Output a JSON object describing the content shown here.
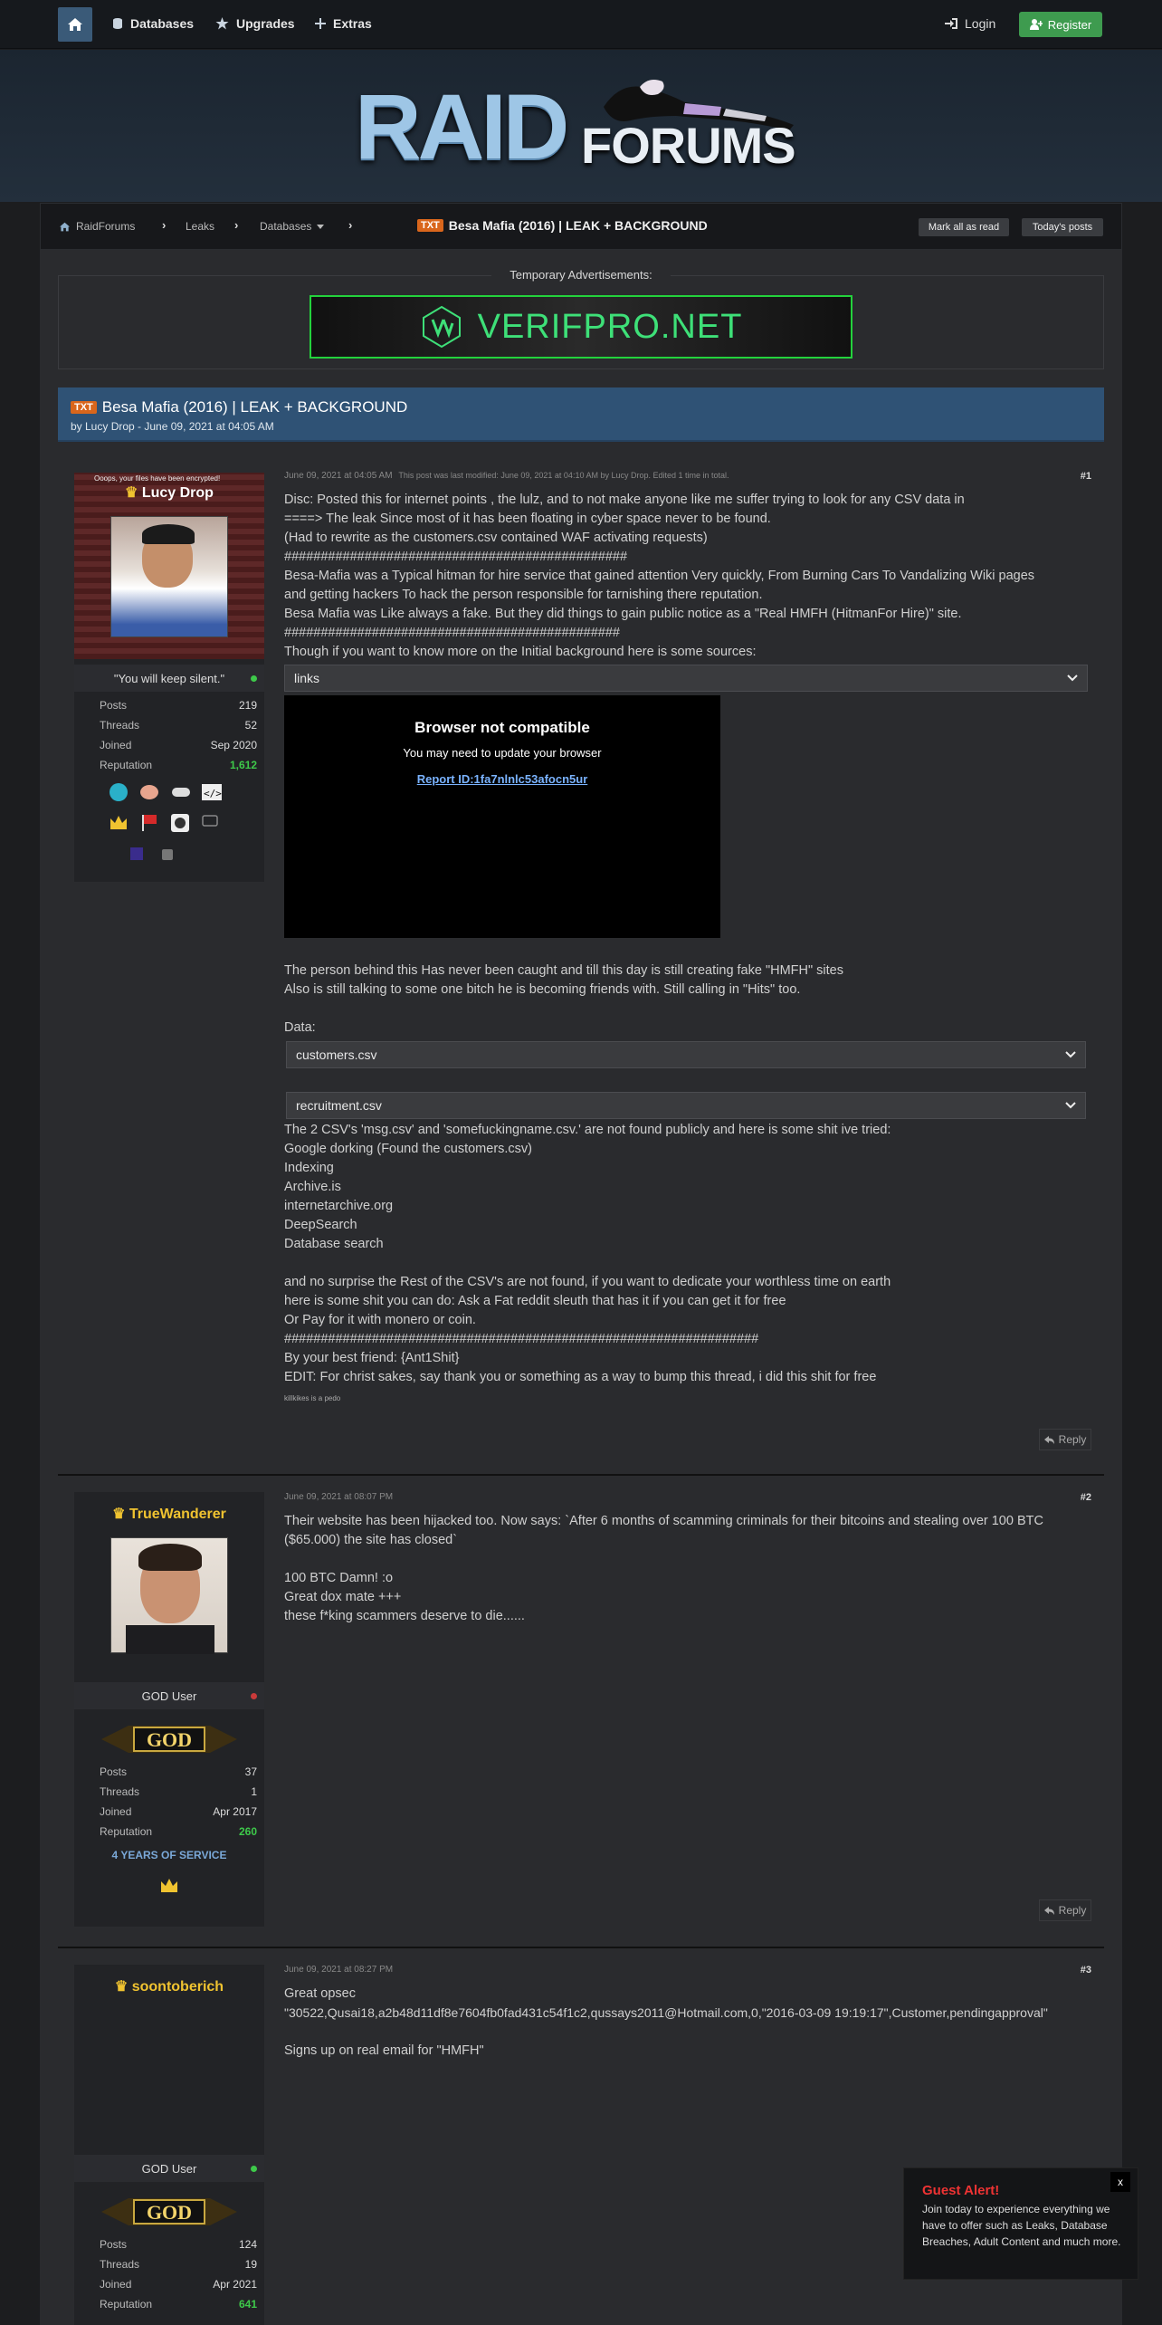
{
  "nav": {
    "databases": "Databases",
    "upgrades": "Upgrades",
    "extras": "Extras",
    "login": "Login",
    "register": "Register"
  },
  "logo": {
    "raid": "RAID",
    "forums": "FORUMS"
  },
  "breadcrumb": {
    "home": "RaidForums",
    "leaks": "Leaks",
    "databases": "Databases",
    "tag": "TXT",
    "title": "Besa Mafia (2016) | LEAK + BACKGROUND",
    "mark_read": "Mark all as read",
    "todays": "Today's posts"
  },
  "ads": {
    "label": "Temporary Advertisements:",
    "ad_text": "VERIFPRO.NET"
  },
  "thread": {
    "tag": "TXT",
    "title": "Besa Mafia (2016) | LEAK + BACKGROUND",
    "byline": "by Lucy Drop - June 09, 2021 at 04:05 AM"
  },
  "posts": [
    {
      "author": "Lucy Drop",
      "avatar_top_text": "Ooops, your files have been encrypted!",
      "user_title": "\"You will keep silent.\"",
      "online": true,
      "stats": {
        "posts_label": "Posts",
        "posts": "219",
        "threads_label": "Threads",
        "threads": "52",
        "joined_label": "Joined",
        "joined": "Sep 2020",
        "rep_label": "Reputation",
        "rep": "1,612"
      },
      "date": "June 09, 2021 at 04:05 AM",
      "modified": "This post was last modified: June 09, 2021 at 04:10 AM by Lucy Drop. Edited 1 time in total.",
      "number": "#1",
      "lines": [
        "Disc: Posted this for internet points , the lulz, and to not make anyone like me suffer trying to look for any CSV data in",
        "====> The leak Since most of it has been floating in cyber space never to be found.",
        "(Had to rewrite as the customers.csv contained WAF activating requests)",
        "###############################################",
        "Besa-Mafia was a Typical hitman for hire service that gained attention Very quickly, From Burning Cars To Vandalizing Wiki pages",
        "and getting hackers To hack the person responsible for tarnishing there reputation.",
        "Besa Mafia was Like always a fake. But they did things to gain public notice as a \"Real HMFH (HitmanFor Hire)\" site.",
        "##############################################",
        "Though if you want to know more on the Initial background here is some sources:"
      ],
      "spoiler1": "links",
      "video": {
        "title": "Browser not compatible",
        "sub": "You may need to update your browser",
        "link": "Report ID:1fa7nlnlc53afocn5ur"
      },
      "lines2": [
        "The person behind this Has never been caught and till this day is still creating fake \"HMFH\" sites",
        "Also is still talking to some one bitch he is becoming friends with. Still calling in \"Hits\" too."
      ],
      "data_label": "Data:",
      "spoiler2": "customers.csv",
      "spoiler3": "recruitment.csv",
      "lines3": [
        "The 2 CSV's 'msg.csv' and 'somefuckingname.csv.' are not found publicly and here is some shit ive tried:",
        "Google dorking (Found the customers.csv)",
        "Indexing",
        "Archive.is",
        "internetarchive.org",
        "DeepSearch",
        "Database search"
      ],
      "lines4": [
        "and no surprise the Rest of the CSV's are not found, if you want to dedicate your worthless time on earth",
        "here is some shit you can do: Ask a Fat reddit sleuth that has it if you can get it for free",
        "Or Pay for it with monero or coin.",
        "#################################################################",
        "By your best friend: {Ant1Shit}",
        "EDIT: For christ sakes, say thank you or something as a way to bump this thread, i did this shit for free"
      ],
      "signature": "killkikes is a pedo",
      "reply": "Reply"
    },
    {
      "author": "TrueWanderer",
      "user_title": "GOD User",
      "badge": "GOD",
      "stats": {
        "posts_label": "Posts",
        "posts": "37",
        "threads_label": "Threads",
        "threads": "1",
        "joined_label": "Joined",
        "joined": "Apr 2017",
        "rep_label": "Reputation",
        "rep": "260"
      },
      "service": "4 YEARS OF SERVICE",
      "date": "June 09, 2021 at 08:07 PM",
      "number": "#2",
      "lines": [
        "Their website has been hijacked too. Now says: `After 6 months of scamming criminals for their bitcoins and stealing over 100 BTC",
        "($65.000) the site has closed`",
        "",
        "100 BTC Damn! :o",
        "Great dox mate +++",
        "these f*king scammers deserve to die......"
      ],
      "reply": "Reply"
    },
    {
      "author": "soontoberich",
      "user_title": "GOD User",
      "badge": "GOD",
      "stats": {
        "posts_label": "Posts",
        "posts": "124",
        "threads_label": "Threads",
        "threads": "19",
        "joined_label": "Joined",
        "joined": "Apr 2021",
        "rep_label": "Reputation",
        "rep": "641"
      },
      "date": "June 09, 2021 at 08:27 PM",
      "number": "#3",
      "lines": [
        "Great opsec",
        "\"30522,Qusai18,a2b48d11df8e7604fb0fad431c54f1c2,qussays2011@Hotmail.com,0,\"2016-03-09 19:19:17\",Customer,pendingapproval\"",
        "",
        "Signs up on real email for \"HMFH\""
      ]
    }
  ],
  "guest": {
    "title": "Guest Alert!",
    "body": "Join today to experience everything we have to offer such as Leaks, Database Breaches, Adult Content and much more.",
    "close": "x"
  },
  "colors": {
    "accent": "#2f5275",
    "register": "#3e9b4f",
    "reputation": "#3ec94a",
    "username": "#f0c330",
    "tag": "#d9661c"
  }
}
